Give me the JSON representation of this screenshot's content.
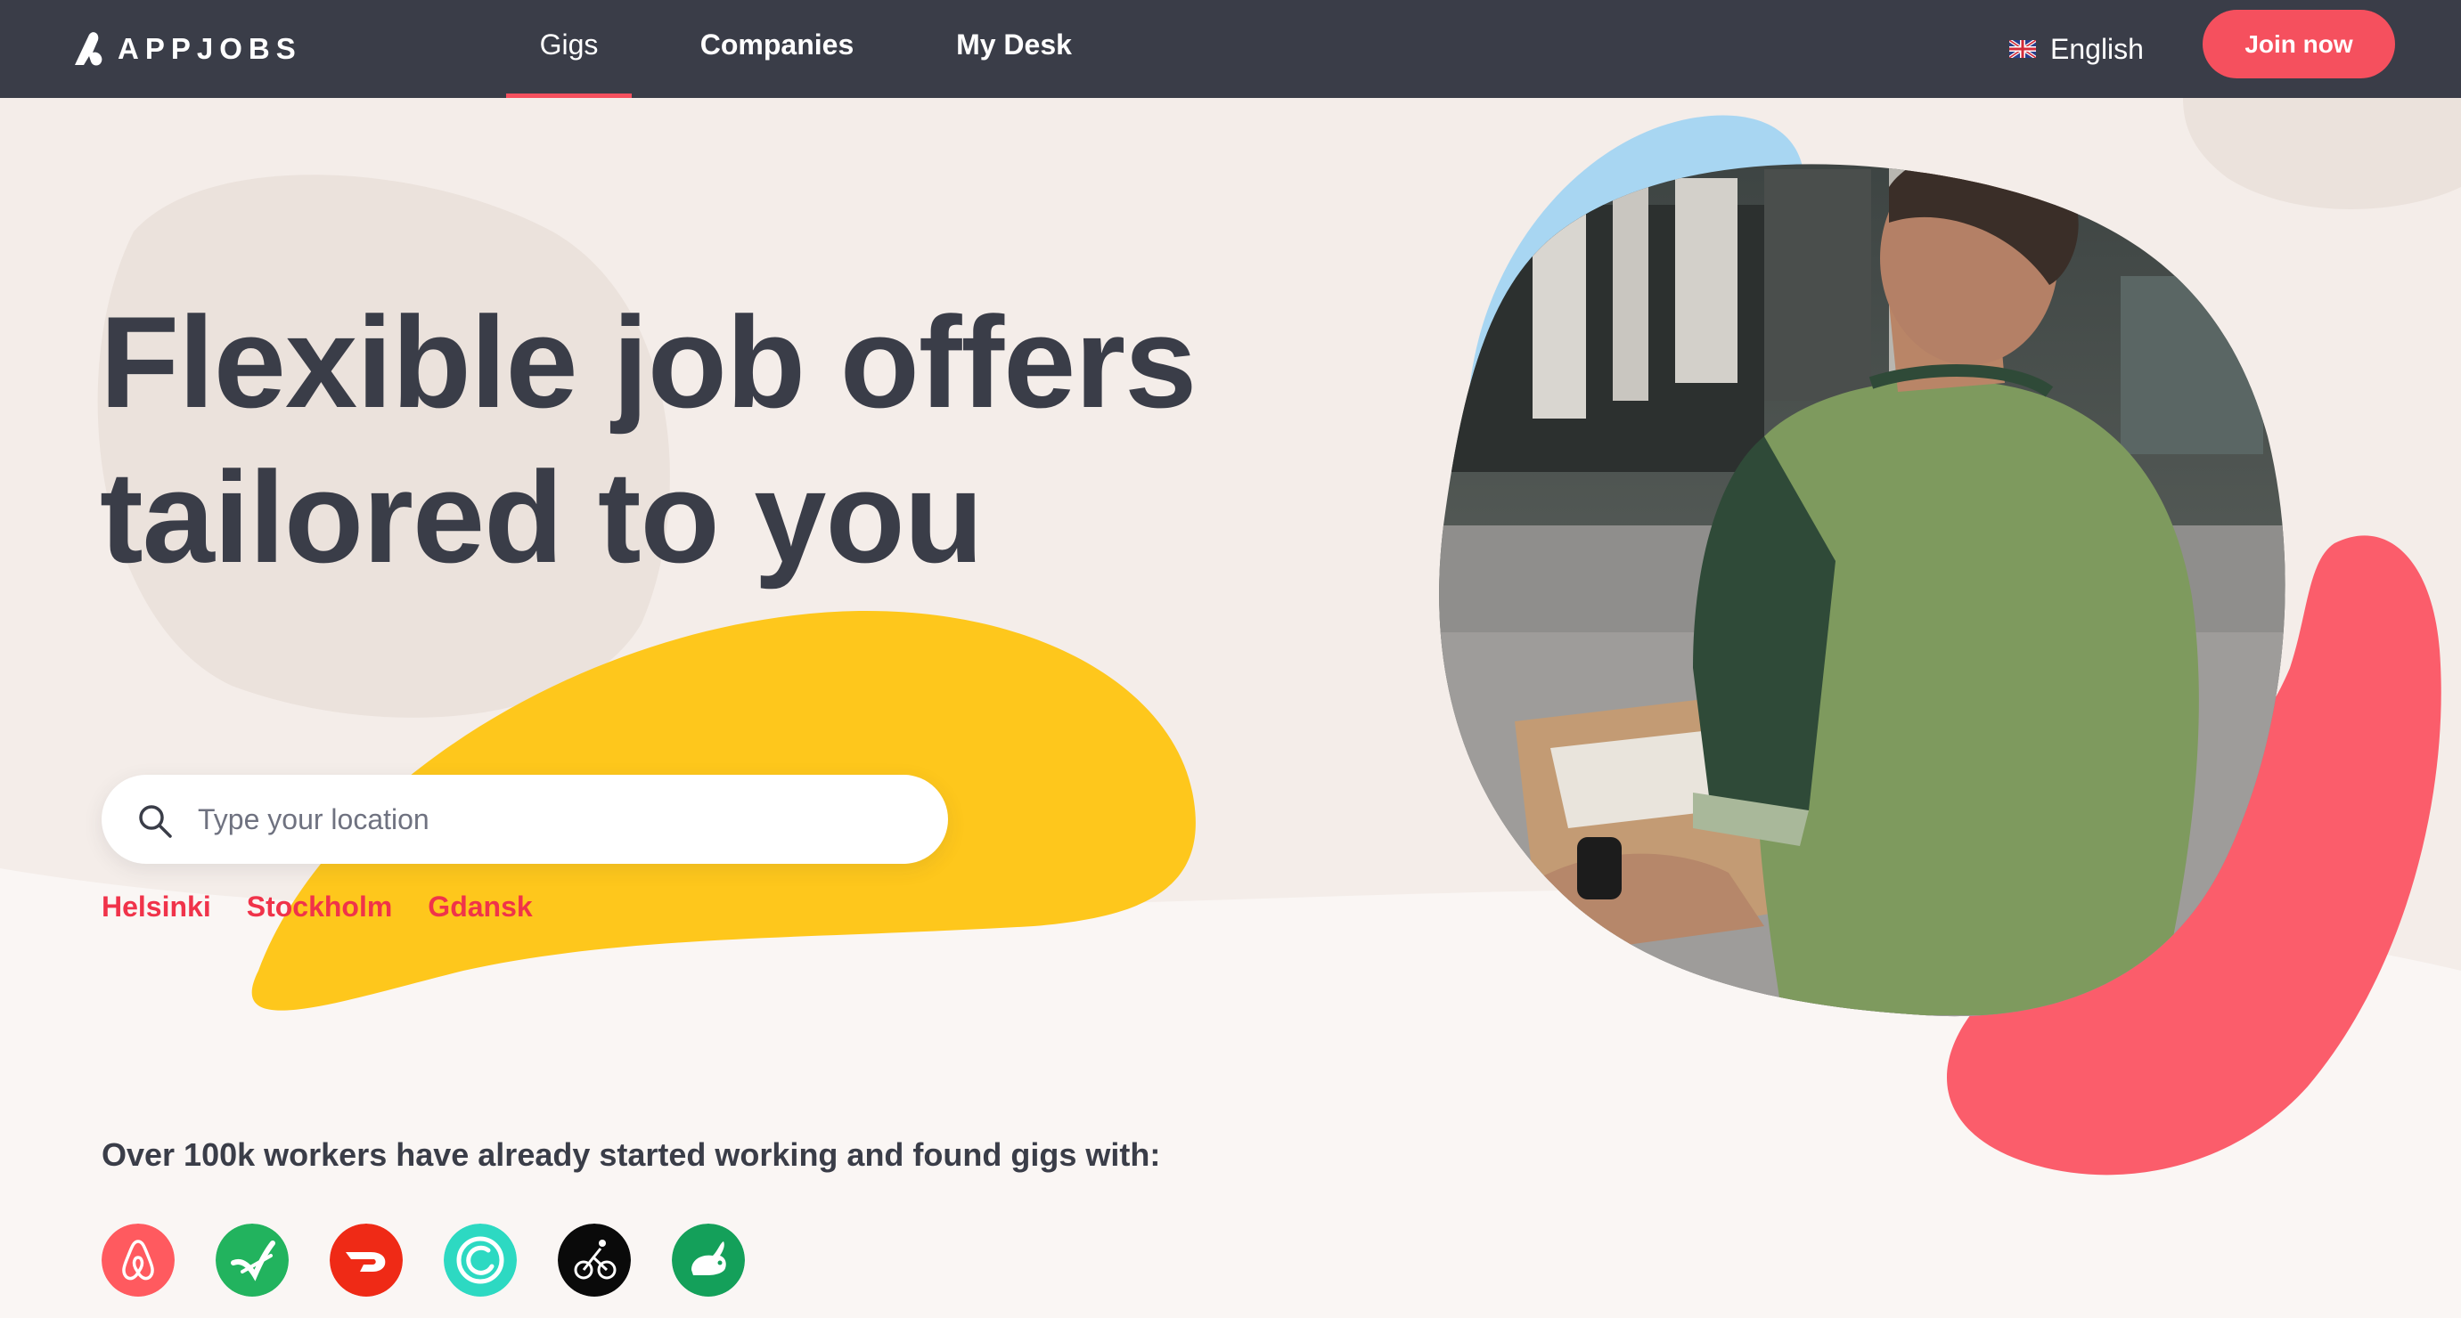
{
  "brand": {
    "name": "APPJOBS"
  },
  "nav": {
    "links": [
      {
        "label": "Gigs",
        "active": true
      },
      {
        "label": "Companies",
        "active": false
      },
      {
        "label": "My Desk",
        "active": false
      }
    ],
    "language": "English",
    "join_label": "Join now"
  },
  "hero": {
    "headline_line1": "Flexible job offers",
    "headline_line2": "tailored to you"
  },
  "search": {
    "placeholder": "Type your location",
    "value": ""
  },
  "cities": [
    "Helsinki",
    "Stockholm",
    "Gdansk"
  ],
  "tagline": "Over 100k workers have already started working and found gigs with:",
  "partners": [
    {
      "icon": "airbnb-icon",
      "color": "#ff5a5f"
    },
    {
      "icon": "postmates-icon",
      "color": "#22b35e"
    },
    {
      "icon": "doordash-icon",
      "color": "#ef2a16"
    },
    {
      "icon": "instacart-icon",
      "color": "#2dd9c2"
    },
    {
      "icon": "cyclist-icon",
      "color": "#0a0a0a"
    },
    {
      "icon": "taskrabbit-icon",
      "color": "#14a05a"
    }
  ],
  "colors": {
    "navbar": "#3a3d48",
    "accent": "#f5505e",
    "link": "#f0334a",
    "yellow_blob": "#fec71c",
    "blue_blob": "#a8d6f2",
    "pink_blob": "#fb5d6b",
    "background": "#f4ede9"
  }
}
